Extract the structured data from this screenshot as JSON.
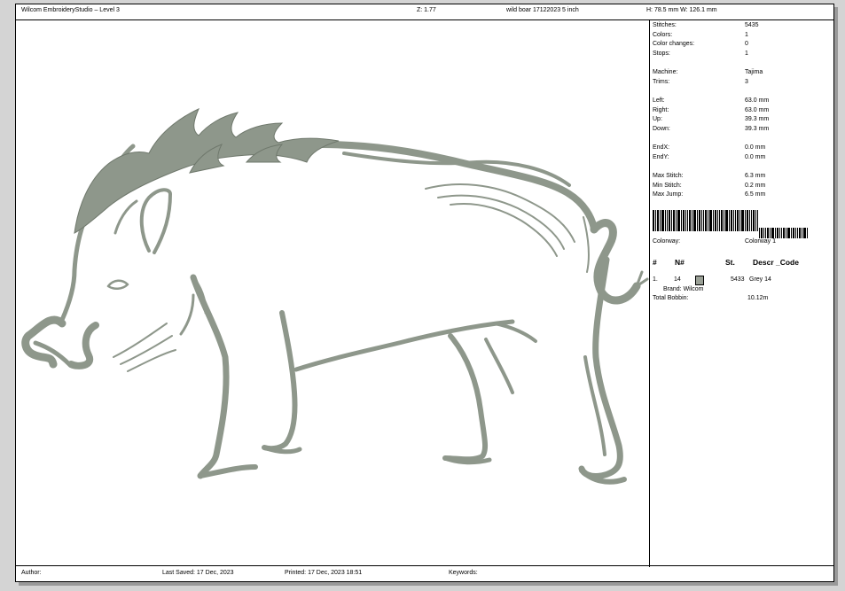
{
  "header": {
    "app_title": "Wilcom EmbroideryStudio – Level 3",
    "zoom": "Z: 1.77",
    "design_name": "wild boar 17122023 5 inch",
    "dimensions": "H: 78.5 mm   W: 126.1 mm"
  },
  "stats": [
    {
      "label": "Stitches:",
      "value": "5435"
    },
    {
      "label": "Colors:",
      "value": "1"
    },
    {
      "label": "Color changes:",
      "value": "0"
    },
    {
      "label": "Stops:",
      "value": "1"
    },
    {
      "label": "Machine:",
      "value": "Tajima"
    },
    {
      "label": "Trims:",
      "value": "3"
    },
    {
      "label": "Left:",
      "value": "63.0 mm"
    },
    {
      "label": "Right:",
      "value": "63.0 mm"
    },
    {
      "label": "Up:",
      "value": "39.3 mm"
    },
    {
      "label": "Down:",
      "value": "39.3 mm"
    },
    {
      "label": "EndX:",
      "value": "0.0 mm"
    },
    {
      "label": "EndY:",
      "value": "0.0 mm"
    },
    {
      "label": "Max Stitch:",
      "value": "6.3 mm"
    },
    {
      "label": "Min Stitch:",
      "value": "0.2 mm"
    },
    {
      "label": "Max Jump:",
      "value": "6.5 mm"
    }
  ],
  "colorway": {
    "label": "Colorway:",
    "value": "Colorway 1"
  },
  "thread_table": {
    "headers": {
      "num": "#",
      "needle": "N#",
      "stitches": "St.",
      "descr": "Descr _Code"
    },
    "rows": [
      {
        "num": "1.",
        "needle": "14",
        "stitches": "5433",
        "descr": "Grey 14",
        "brand": "Brand: Wilcom"
      }
    ],
    "swatch_color": "#9aa096"
  },
  "bobbin": {
    "label": "Total Bobbin:",
    "value": "10.12m"
  },
  "footer": {
    "author": "Author:",
    "last_saved": "Last Saved: 17 Dec, 2023",
    "printed": "Printed: 17 Dec, 2023 18:51",
    "keywords": "Keywords:"
  },
  "design": {
    "thread_color": "#8e978b",
    "thread_dark": "#6f786c"
  }
}
